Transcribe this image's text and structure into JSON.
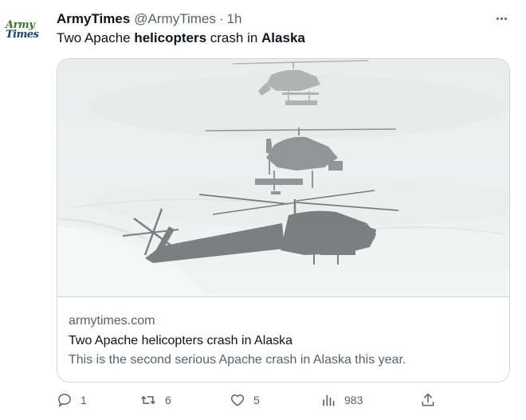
{
  "author": {
    "avatar_line1": "Army",
    "avatar_line2": "Times",
    "name": "ArmyTimes",
    "handle": "@ArmyTimes",
    "separator": "·",
    "time": "1h"
  },
  "tweet": {
    "parts": [
      {
        "text": "Two Apache ",
        "bold": false
      },
      {
        "text": "helicopters",
        "bold": true
      },
      {
        "text": " crash in ",
        "bold": false
      },
      {
        "text": "Alaska",
        "bold": true
      }
    ]
  },
  "card": {
    "image_icon": "apache-helicopters-in-snow-image",
    "domain": "armytimes.com",
    "title": "Two Apache helicopters crash in Alaska",
    "description": "This is the second serious Apache crash in Alaska this year."
  },
  "actions": {
    "reply_count": "1",
    "retweet_count": "6",
    "like_count": "5",
    "views_count": "983"
  },
  "colors": {
    "text_primary": "#0f1419",
    "text_secondary": "#536471",
    "border": "#cfd9de",
    "avatar_green": "#3d7a2e",
    "avatar_blue": "#1f3f6e"
  }
}
